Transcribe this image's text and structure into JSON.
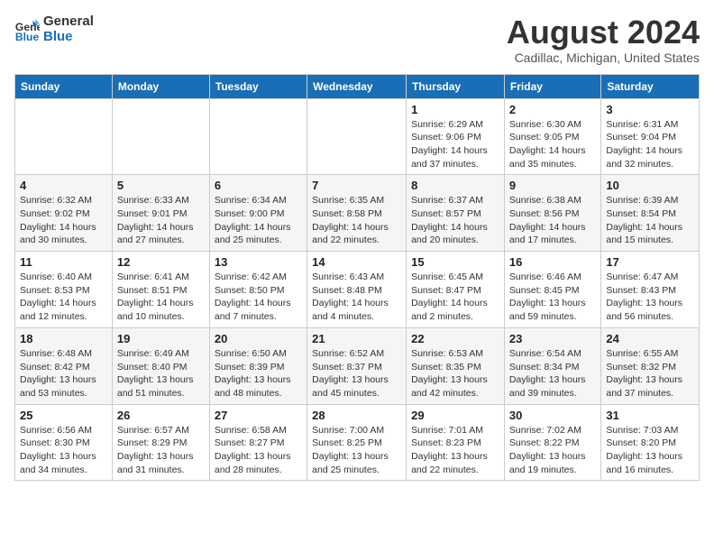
{
  "logo": {
    "line1": "General",
    "line2": "Blue"
  },
  "title": "August 2024",
  "subtitle": "Cadillac, Michigan, United States",
  "days_header": [
    "Sunday",
    "Monday",
    "Tuesday",
    "Wednesday",
    "Thursday",
    "Friday",
    "Saturday"
  ],
  "weeks": [
    [
      {
        "day": "",
        "info": ""
      },
      {
        "day": "",
        "info": ""
      },
      {
        "day": "",
        "info": ""
      },
      {
        "day": "",
        "info": ""
      },
      {
        "day": "1",
        "info": "Sunrise: 6:29 AM\nSunset: 9:06 PM\nDaylight: 14 hours\nand 37 minutes."
      },
      {
        "day": "2",
        "info": "Sunrise: 6:30 AM\nSunset: 9:05 PM\nDaylight: 14 hours\nand 35 minutes."
      },
      {
        "day": "3",
        "info": "Sunrise: 6:31 AM\nSunset: 9:04 PM\nDaylight: 14 hours\nand 32 minutes."
      }
    ],
    [
      {
        "day": "4",
        "info": "Sunrise: 6:32 AM\nSunset: 9:02 PM\nDaylight: 14 hours\nand 30 minutes."
      },
      {
        "day": "5",
        "info": "Sunrise: 6:33 AM\nSunset: 9:01 PM\nDaylight: 14 hours\nand 27 minutes."
      },
      {
        "day": "6",
        "info": "Sunrise: 6:34 AM\nSunset: 9:00 PM\nDaylight: 14 hours\nand 25 minutes."
      },
      {
        "day": "7",
        "info": "Sunrise: 6:35 AM\nSunset: 8:58 PM\nDaylight: 14 hours\nand 22 minutes."
      },
      {
        "day": "8",
        "info": "Sunrise: 6:37 AM\nSunset: 8:57 PM\nDaylight: 14 hours\nand 20 minutes."
      },
      {
        "day": "9",
        "info": "Sunrise: 6:38 AM\nSunset: 8:56 PM\nDaylight: 14 hours\nand 17 minutes."
      },
      {
        "day": "10",
        "info": "Sunrise: 6:39 AM\nSunset: 8:54 PM\nDaylight: 14 hours\nand 15 minutes."
      }
    ],
    [
      {
        "day": "11",
        "info": "Sunrise: 6:40 AM\nSunset: 8:53 PM\nDaylight: 14 hours\nand 12 minutes."
      },
      {
        "day": "12",
        "info": "Sunrise: 6:41 AM\nSunset: 8:51 PM\nDaylight: 14 hours\nand 10 minutes."
      },
      {
        "day": "13",
        "info": "Sunrise: 6:42 AM\nSunset: 8:50 PM\nDaylight: 14 hours\nand 7 minutes."
      },
      {
        "day": "14",
        "info": "Sunrise: 6:43 AM\nSunset: 8:48 PM\nDaylight: 14 hours\nand 4 minutes."
      },
      {
        "day": "15",
        "info": "Sunrise: 6:45 AM\nSunset: 8:47 PM\nDaylight: 14 hours\nand 2 minutes."
      },
      {
        "day": "16",
        "info": "Sunrise: 6:46 AM\nSunset: 8:45 PM\nDaylight: 13 hours\nand 59 minutes."
      },
      {
        "day": "17",
        "info": "Sunrise: 6:47 AM\nSunset: 8:43 PM\nDaylight: 13 hours\nand 56 minutes."
      }
    ],
    [
      {
        "day": "18",
        "info": "Sunrise: 6:48 AM\nSunset: 8:42 PM\nDaylight: 13 hours\nand 53 minutes."
      },
      {
        "day": "19",
        "info": "Sunrise: 6:49 AM\nSunset: 8:40 PM\nDaylight: 13 hours\nand 51 minutes."
      },
      {
        "day": "20",
        "info": "Sunrise: 6:50 AM\nSunset: 8:39 PM\nDaylight: 13 hours\nand 48 minutes."
      },
      {
        "day": "21",
        "info": "Sunrise: 6:52 AM\nSunset: 8:37 PM\nDaylight: 13 hours\nand 45 minutes."
      },
      {
        "day": "22",
        "info": "Sunrise: 6:53 AM\nSunset: 8:35 PM\nDaylight: 13 hours\nand 42 minutes."
      },
      {
        "day": "23",
        "info": "Sunrise: 6:54 AM\nSunset: 8:34 PM\nDaylight: 13 hours\nand 39 minutes."
      },
      {
        "day": "24",
        "info": "Sunrise: 6:55 AM\nSunset: 8:32 PM\nDaylight: 13 hours\nand 37 minutes."
      }
    ],
    [
      {
        "day": "25",
        "info": "Sunrise: 6:56 AM\nSunset: 8:30 PM\nDaylight: 13 hours\nand 34 minutes."
      },
      {
        "day": "26",
        "info": "Sunrise: 6:57 AM\nSunset: 8:29 PM\nDaylight: 13 hours\nand 31 minutes."
      },
      {
        "day": "27",
        "info": "Sunrise: 6:58 AM\nSunset: 8:27 PM\nDaylight: 13 hours\nand 28 minutes."
      },
      {
        "day": "28",
        "info": "Sunrise: 7:00 AM\nSunset: 8:25 PM\nDaylight: 13 hours\nand 25 minutes."
      },
      {
        "day": "29",
        "info": "Sunrise: 7:01 AM\nSunset: 8:23 PM\nDaylight: 13 hours\nand 22 minutes."
      },
      {
        "day": "30",
        "info": "Sunrise: 7:02 AM\nSunset: 8:22 PM\nDaylight: 13 hours\nand 19 minutes."
      },
      {
        "day": "31",
        "info": "Sunrise: 7:03 AM\nSunset: 8:20 PM\nDaylight: 13 hours\nand 16 minutes."
      }
    ]
  ]
}
